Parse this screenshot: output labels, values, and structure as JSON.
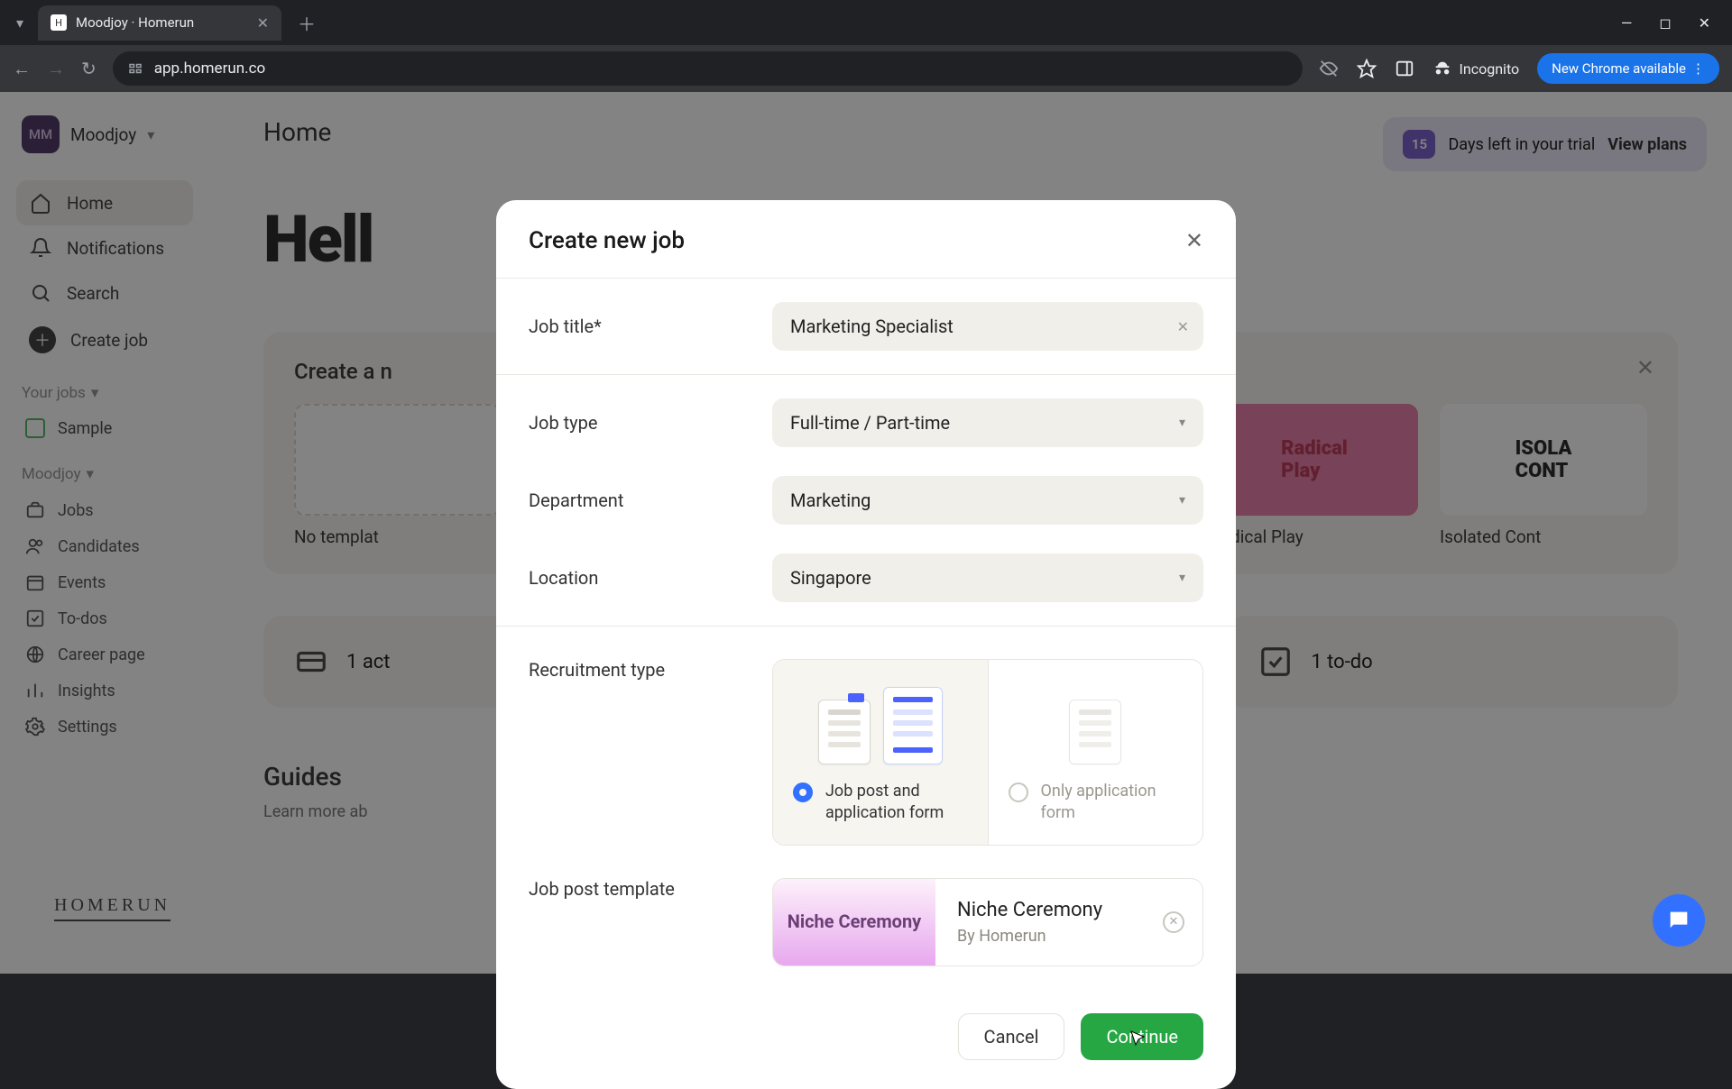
{
  "browser": {
    "tab_title": "Moodjoy · Homerun",
    "url": "app.homerun.co",
    "incognito_label": "Incognito",
    "update_label": "New Chrome available"
  },
  "workspace": {
    "initials": "MM",
    "name": "Moodjoy"
  },
  "nav": {
    "home": "Home",
    "notifications": "Notifications",
    "search": "Search",
    "create_job": "Create job",
    "your_jobs_label": "Your jobs",
    "sample": "Sample",
    "moodjoy_label": "Moodjoy",
    "jobs": "Jobs",
    "candidates": "Candidates",
    "events": "Events",
    "todos": "To-dos",
    "career_page": "Career page",
    "insights": "Insights",
    "settings": "Settings"
  },
  "page": {
    "title": "Home",
    "hello": "Hell",
    "strip_title": "Create a n",
    "no_template": "No templat",
    "tpl_radical": "Radical Play",
    "tpl_isolated": "Isolated Cont",
    "stats": {
      "active": "1 act",
      "todo": "1 to-do"
    },
    "guides_title": "Guides",
    "guides_sub": "Learn more ab"
  },
  "trial": {
    "days": "15",
    "text": "Days left in your trial",
    "cta": "View plans"
  },
  "modal": {
    "title": "Create new job",
    "labels": {
      "job_title": "Job title",
      "job_type": "Job type",
      "department": "Department",
      "location": "Location",
      "recruitment_type": "Recruitment type",
      "job_post_template": "Job post template"
    },
    "values": {
      "job_title": "Marketing Specialist",
      "job_type": "Full-time / Part-time",
      "department": "Marketing",
      "location": "Singapore"
    },
    "recruitment": {
      "opt1": "Job post and application form",
      "opt2": "Only application form"
    },
    "template": {
      "thumb_text": "Niche Ceremony",
      "name": "Niche Ceremony",
      "by": "By Homerun"
    },
    "buttons": {
      "cancel": "Cancel",
      "continue": "Continue"
    }
  },
  "logo": "HOMERUN"
}
